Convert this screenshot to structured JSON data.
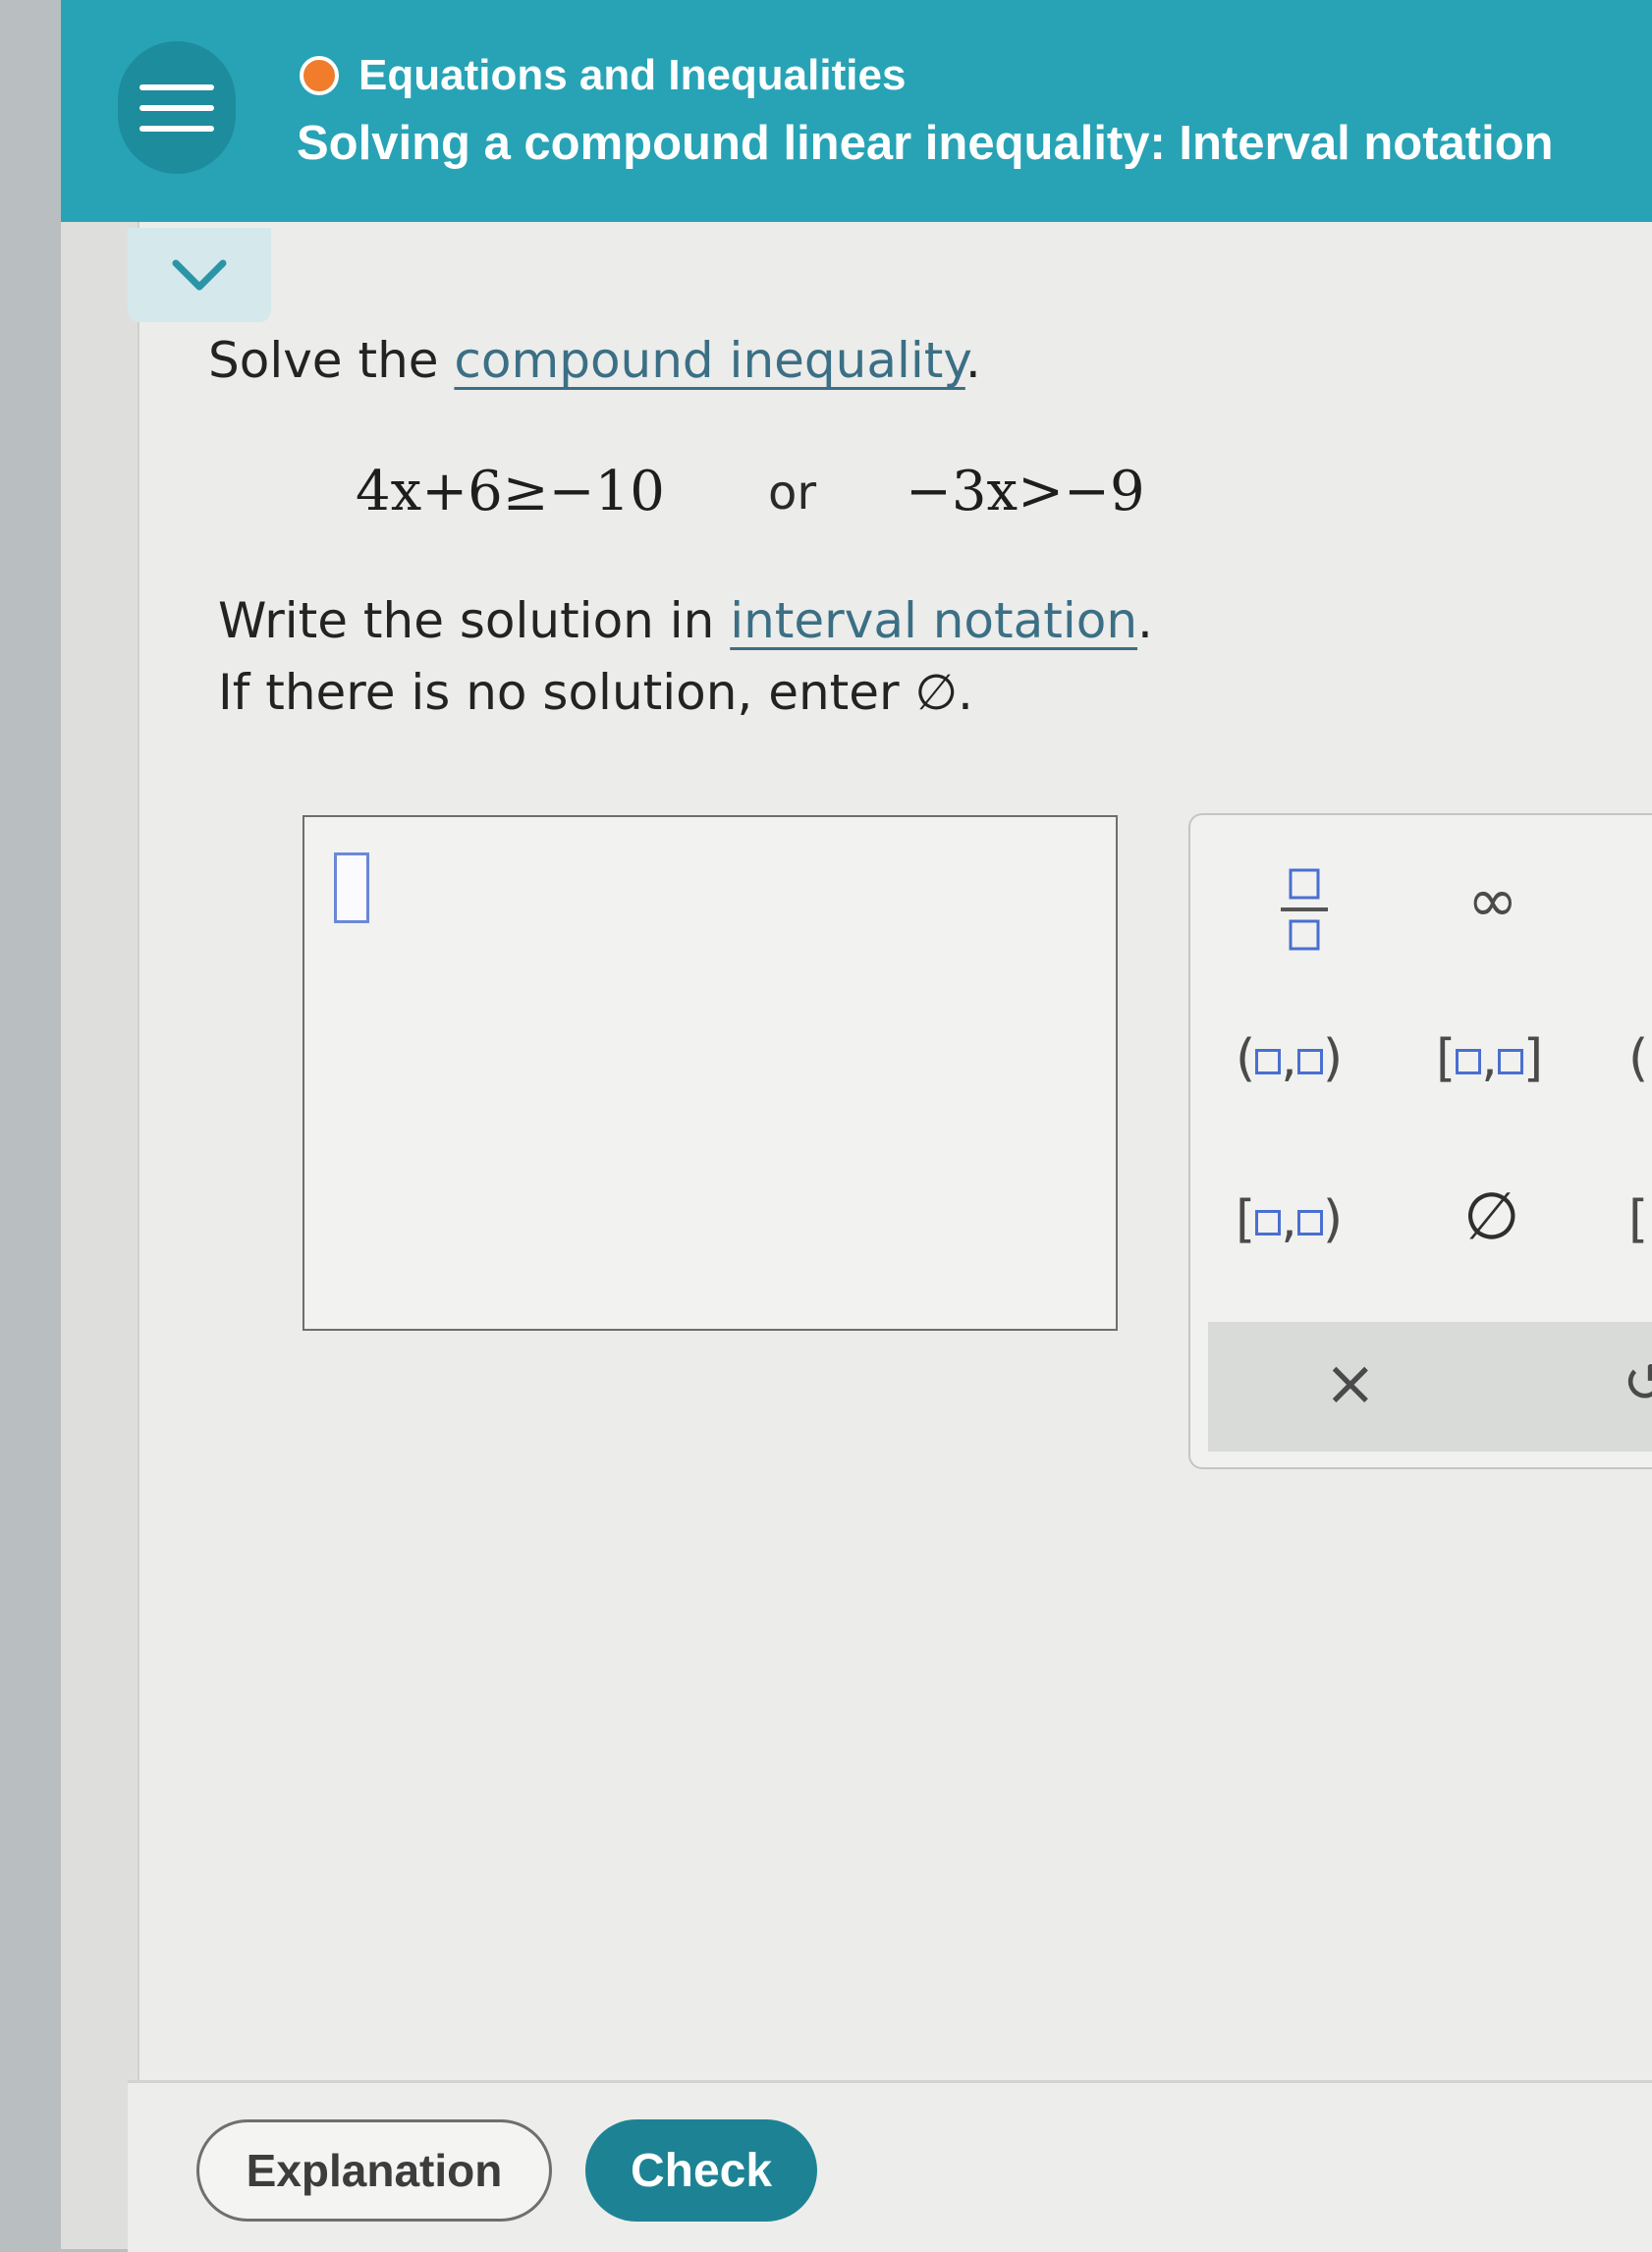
{
  "header": {
    "topic": "Equations and Inequalities",
    "title": "Solving a compound linear inequality: Interval notation"
  },
  "problem": {
    "prompt_prefix": "Solve the ",
    "prompt_link": "compound inequality",
    "prompt_suffix": ".",
    "inequality_left": "4x+6≥−10",
    "connector": "or",
    "inequality_right": "−3x>−9",
    "instruction_prefix": "Write the solution in ",
    "instruction_link": "interval notation",
    "instruction_suffix": ".",
    "no_solution_text": "If there is no solution, enter ∅."
  },
  "answer": {
    "value": ""
  },
  "keypad": {
    "infinity": "∞",
    "open_interval": "(",
    "closed_interval": "[",
    "half_open": "[",
    "empty_set": "∅",
    "clear": "×",
    "undo": "↺",
    "partial_open": "(",
    "partial_closed": "["
  },
  "footer": {
    "explanation_label": "Explanation",
    "check_label": "Check"
  }
}
